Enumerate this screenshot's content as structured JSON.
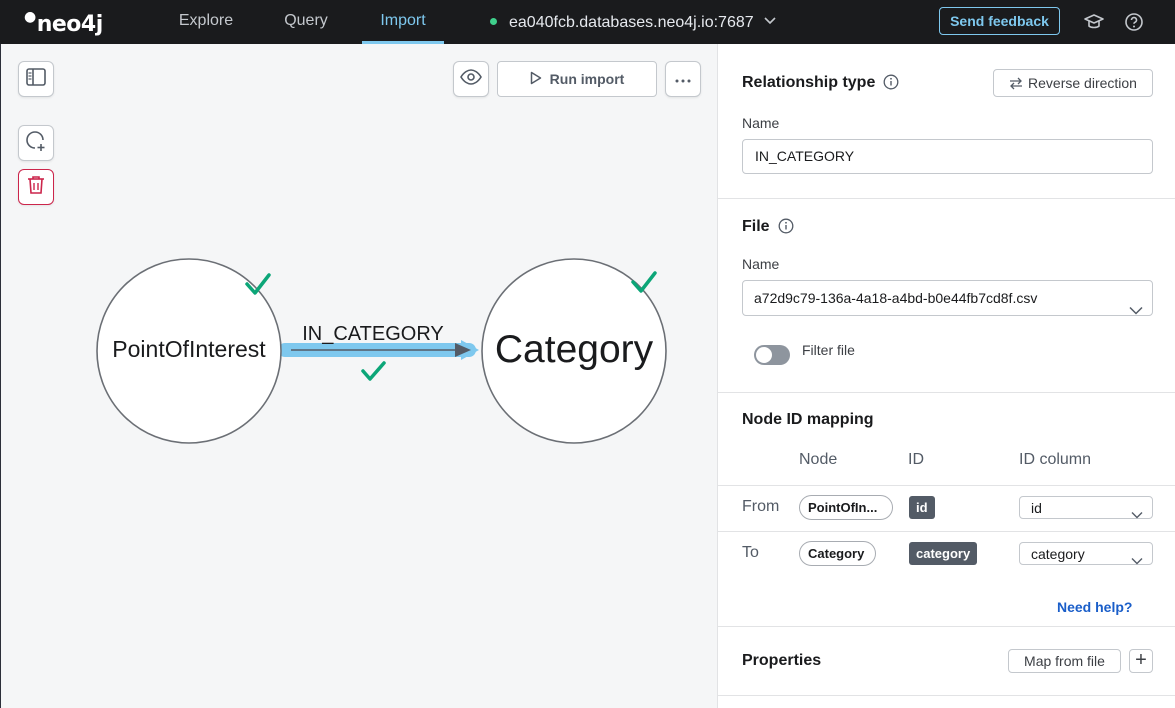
{
  "app": {
    "logo": "neo4j"
  },
  "nav": {
    "tabs": [
      {
        "label": "Explore",
        "active": false
      },
      {
        "label": "Query",
        "active": false
      },
      {
        "label": "Import",
        "active": true
      }
    ],
    "connection": {
      "host": "ea040fcb.databases.neo4j.io:7687",
      "status_color": "#3fd08c"
    },
    "feedback_label": "Send feedback",
    "icons": [
      "graduation-cap-icon",
      "help-icon"
    ]
  },
  "canvas": {
    "toolbar": {
      "run_label": "Run import",
      "icons": [
        "sidebar-toggle-icon",
        "eye-icon",
        "play-icon",
        "more-icon",
        "add-node-icon",
        "trash-icon"
      ]
    },
    "graph": {
      "source_node": "PointOfInterest",
      "target_node": "Category",
      "relationship": "IN_CATEGORY",
      "check_color": "#0ca678",
      "highlight_color": "#7ec8ee"
    }
  },
  "panel": {
    "relationship": {
      "title": "Relationship type",
      "reverse_label": "Reverse direction",
      "name_label": "Name",
      "name_value": "IN_CATEGORY"
    },
    "file": {
      "title": "File",
      "name_label": "Name",
      "selected_file": "a72d9c79-136a-4a18-a4bd-b0e44fb7cd8f.csv",
      "filter_label": "Filter file",
      "filter_enabled": false
    },
    "mapping": {
      "title": "Node ID mapping",
      "columns": [
        "Node",
        "ID",
        "ID column"
      ],
      "rows": [
        {
          "label": "From",
          "node": "PointOfIn...",
          "id": "id",
          "id_column": "id"
        },
        {
          "label": "To",
          "node": "Category",
          "id": "category",
          "id_column": "category"
        }
      ],
      "help_label": "Need help?"
    },
    "properties": {
      "title": "Properties",
      "map_label": "Map from file",
      "add_label": "+"
    }
  }
}
